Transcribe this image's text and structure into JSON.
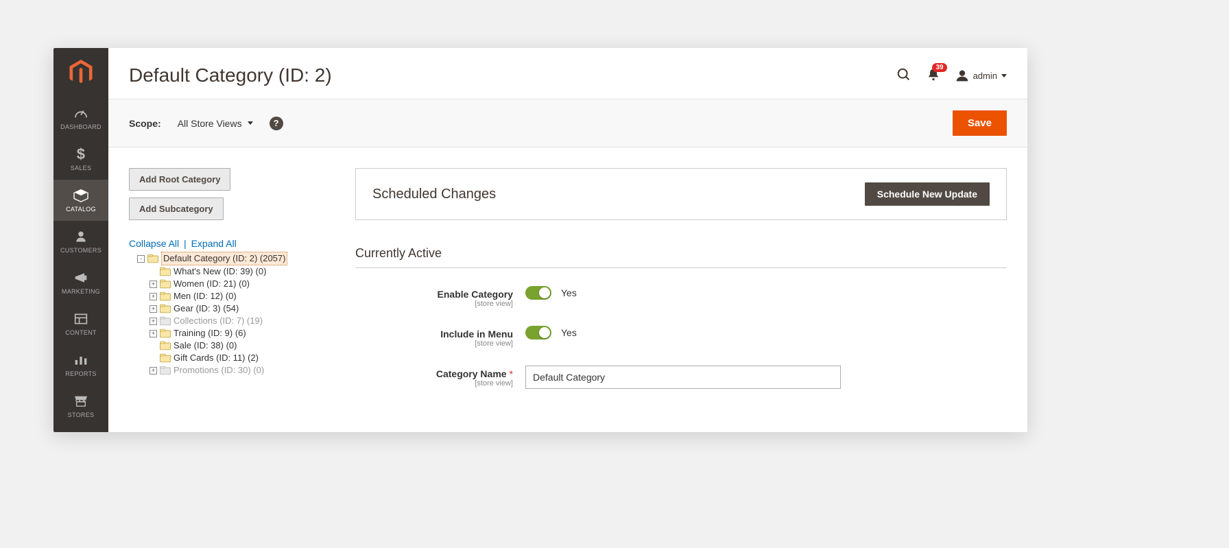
{
  "header": {
    "title": "Default Category (ID: 2)",
    "notifications_count": "39",
    "user": "admin"
  },
  "sidebar": {
    "items": [
      {
        "label": "DASHBOARD",
        "name": "dashboard"
      },
      {
        "label": "SALES",
        "name": "sales"
      },
      {
        "label": "CATALOG",
        "name": "catalog"
      },
      {
        "label": "CUSTOMERS",
        "name": "customers"
      },
      {
        "label": "MARKETING",
        "name": "marketing"
      },
      {
        "label": "CONTENT",
        "name": "content"
      },
      {
        "label": "REPORTS",
        "name": "reports"
      },
      {
        "label": "STORES",
        "name": "stores"
      }
    ],
    "active_index": 2
  },
  "scope": {
    "label": "Scope:",
    "value": "All Store Views",
    "save_label": "Save"
  },
  "tree_buttons": {
    "add_root": "Add Root Category",
    "add_sub": "Add Subcategory",
    "collapse": "Collapse All",
    "expand": "Expand All"
  },
  "tree": [
    {
      "depth": 0,
      "exp": "-",
      "label": "Default Category (ID: 2) (2057)",
      "selected": true,
      "dim": false
    },
    {
      "depth": 1,
      "exp": "",
      "label": "What's New (ID: 39) (0)",
      "selected": false,
      "dim": false
    },
    {
      "depth": 1,
      "exp": "+",
      "label": "Women (ID: 21) (0)",
      "selected": false,
      "dim": false
    },
    {
      "depth": 1,
      "exp": "+",
      "label": "Men (ID: 12) (0)",
      "selected": false,
      "dim": false
    },
    {
      "depth": 1,
      "exp": "+",
      "label": "Gear (ID: 3) (54)",
      "selected": false,
      "dim": false
    },
    {
      "depth": 1,
      "exp": "+",
      "label": "Collections (ID: 7) (19)",
      "selected": false,
      "dim": true
    },
    {
      "depth": 1,
      "exp": "+",
      "label": "Training (ID: 9) (6)",
      "selected": false,
      "dim": false
    },
    {
      "depth": 1,
      "exp": "",
      "label": "Sale (ID: 38) (0)",
      "selected": false,
      "dim": false
    },
    {
      "depth": 1,
      "exp": "",
      "label": "Gift Cards (ID: 11) (2)",
      "selected": false,
      "dim": false
    },
    {
      "depth": 1,
      "exp": "+",
      "label": "Promotions (ID: 30) (0)",
      "selected": false,
      "dim": true
    }
  ],
  "scheduled": {
    "title": "Scheduled Changes",
    "button": "Schedule New Update"
  },
  "form": {
    "section_title": "Currently Active",
    "scope_hint": "[store view]",
    "enable": {
      "label": "Enable Category",
      "value": "Yes"
    },
    "menu": {
      "label": "Include in Menu",
      "value": "Yes"
    },
    "name": {
      "label": "Category Name",
      "value": "Default Category"
    }
  }
}
